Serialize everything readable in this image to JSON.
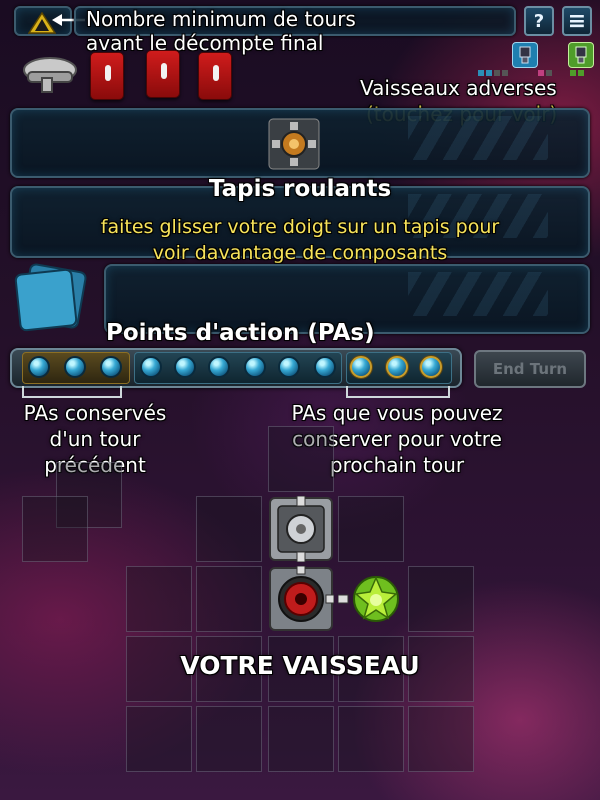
{
  "top": {
    "rounds_label_line1": "Nombre minimum de tours",
    "rounds_label_line2": "avant le décompte final",
    "help_icon_glyph": "?",
    "menu_icon_glyph": "≡"
  },
  "opponents": {
    "title": "Vaisseaux adverses",
    "hint": "(touchez pour voir)"
  },
  "conveyor": {
    "title": "Tapis roulants",
    "hint_line1": "faites glisser votre doigt sur un tapis pour",
    "hint_line2": "voir davantage de composants"
  },
  "action_points": {
    "title": "Points d'action (PAs)",
    "kept_line1": "PAs conservés",
    "kept_line2": "d'un tour",
    "kept_line3": "précédent",
    "save_line1": "PAs que vous pouvez",
    "save_line2": "conserver pour votre",
    "save_line3": "prochain tour",
    "end_turn_label": "End Turn",
    "total_points": 12,
    "kept_points": 3,
    "saveable_points": 3
  },
  "ship": {
    "label": "VOTRE VAISSEAU"
  },
  "colors": {
    "ap_highlight": "#c9a545",
    "teal": "#2b8fb8",
    "yellow_text": "#f7e35a",
    "card_red": "#c41a1a"
  }
}
